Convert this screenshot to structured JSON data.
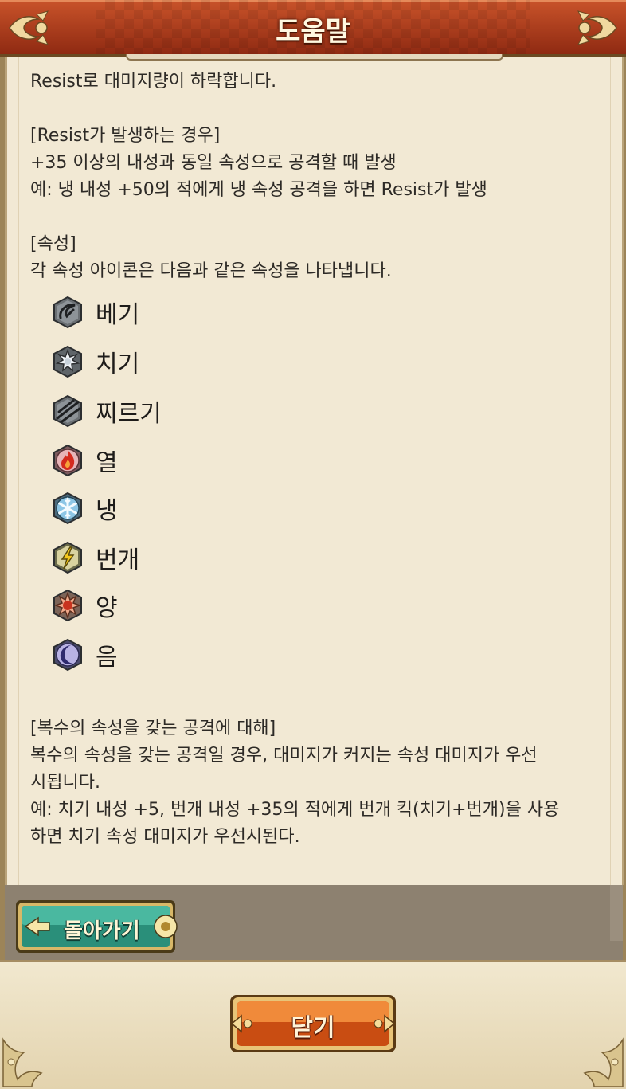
{
  "header": {
    "title": "도움말"
  },
  "body": {
    "intro": "Resist로 대미지량이 하락합니다.",
    "resist_heading": "[Resist가 발생하는 경우]",
    "resist_line1": "+35 이상의 내성과 동일 속성으로 공격할 때 발생",
    "resist_line2": "예: 냉 내성 +50의 적에게 냉 속성 공격을 하면 Resist가 발생",
    "attr_heading": "[속성]",
    "attr_desc": "각 속성 아이콘은 다음과 같은 속성을 나타냅니다.",
    "attributes": [
      {
        "icon": "slash-icon",
        "label": "베기"
      },
      {
        "icon": "strike-icon",
        "label": "치기"
      },
      {
        "icon": "pierce-icon",
        "label": "찌르기"
      },
      {
        "icon": "fire-icon",
        "label": "열"
      },
      {
        "icon": "ice-icon",
        "label": "냉"
      },
      {
        "icon": "lightning-icon",
        "label": "번개"
      },
      {
        "icon": "light-icon",
        "label": "양"
      },
      {
        "icon": "dark-icon",
        "label": "음"
      }
    ],
    "multi_heading": "[복수의 속성을 갖는 공격에 대해]",
    "multi_line1": "복수의 속성을 갖는 공격일 경우, 대미지가 커지는 속성 대미지가 우선",
    "multi_line2": "시됩니다.",
    "multi_line3": "예: 치기 내성 +5, 번개 내성 +35의 적에게 번개 킥(치기+번개)을 사용",
    "multi_line4": "하면 치기 속성 대미지가 우선시된다."
  },
  "buttons": {
    "back_label": "돌아가기",
    "close_label": "닫기"
  },
  "colors": {
    "header": "#b8441f",
    "back_button": "#2f9a84",
    "close_button": "#e0691f",
    "panel": "#f2e9d4"
  }
}
